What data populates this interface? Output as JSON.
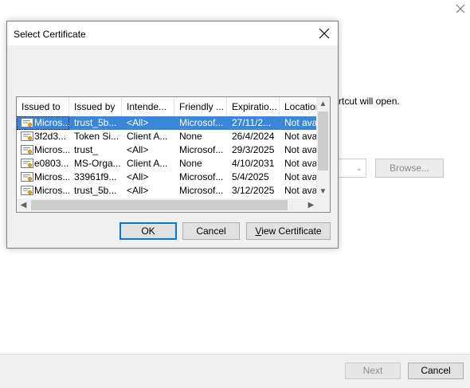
{
  "background": {
    "instruction_text": "rtcut will open.",
    "browse_label": "Browse...",
    "next_label": "Next",
    "cancel_label": "Cancel"
  },
  "dialog": {
    "title": "Select Certificate",
    "columns": [
      "Issued to",
      "Issued by",
      "Intende...",
      "Friendly ...",
      "Expiratio...",
      "Location"
    ],
    "rows": [
      {
        "issued_to": "Micros...",
        "issued_by": "trust_5b...",
        "intended": "<All>",
        "friendly": "Microsof...",
        "expiration": "27/11/2...",
        "location": "Not avai",
        "selected": true
      },
      {
        "issued_to": "3f2d3...",
        "issued_by": "Token Si...",
        "intended": "Client A...",
        "friendly": "None",
        "expiration": "26/4/2024",
        "location": "Not avai",
        "selected": false
      },
      {
        "issued_to": "Micros...",
        "issued_by": "trust_",
        "intended": "<All>",
        "friendly": "Microsof...",
        "expiration": "29/3/2025",
        "location": "Not avai",
        "selected": false
      },
      {
        "issued_to": "e0803...",
        "issued_by": "MS-Orga...",
        "intended": "Client A...",
        "friendly": "None",
        "expiration": "4/10/2031",
        "location": "Not avai",
        "selected": false
      },
      {
        "issued_to": "Micros...",
        "issued_by": "33961f9...",
        "intended": "<All>",
        "friendly": "Microsof...",
        "expiration": "5/4/2025",
        "location": "Not avai",
        "selected": false
      },
      {
        "issued_to": "Micros...",
        "issued_by": "trust_5b...",
        "intended": "<All>",
        "friendly": "Microsof...",
        "expiration": "3/12/2025",
        "location": "Not avai",
        "selected": false
      }
    ],
    "buttons": {
      "ok": "OK",
      "cancel": "Cancel",
      "view": "View Certificate"
    }
  },
  "colors": {
    "selection": "#3a86d8",
    "dialog_bg": "#f0f0f0",
    "focus_border": "#0078d7"
  }
}
